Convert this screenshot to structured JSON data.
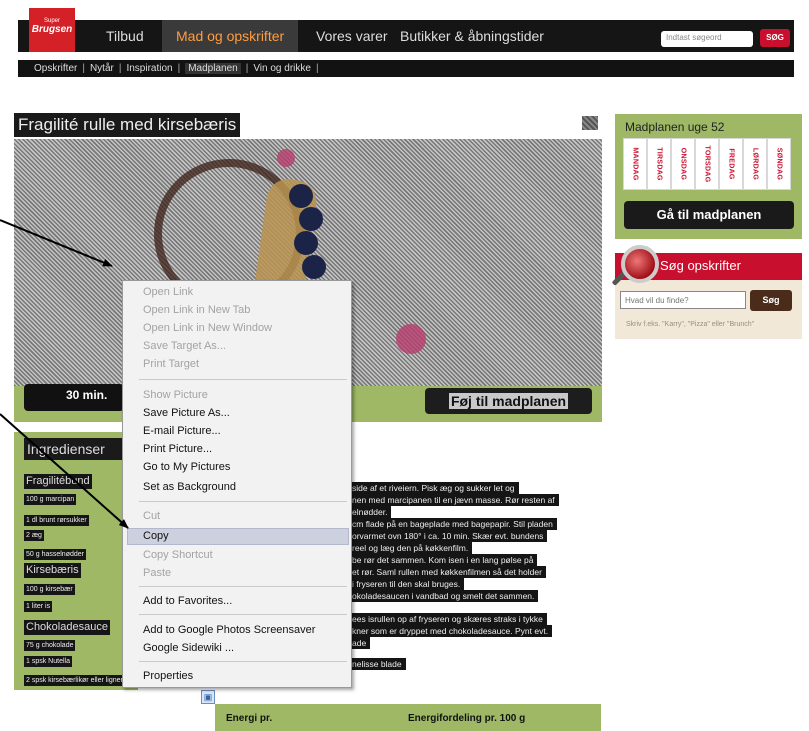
{
  "header": {
    "logo": {
      "line1": "Super",
      "line2": "Brugsen"
    },
    "nav": [
      "Tilbud",
      "Mad og opskrifter",
      "Vores varer",
      "Butikker & åbningstider"
    ],
    "search_placeholder": "Indtast søgeord",
    "search_button": "SØG",
    "subnav": [
      "Opskrifter",
      "Nytår",
      "Inspiration",
      "Madplanen",
      "Vin og drikke"
    ]
  },
  "recipe": {
    "title": "Fragilité rulle med kirsebæris",
    "time": "30 min.",
    "add_to_plan": "Føj til madplanen"
  },
  "ingredients": {
    "title": "Ingredienser",
    "groups": [
      {
        "name": "Fragilitébund",
        "items": [
          "100 g marcipan",
          "1 dl brunt rørsukker",
          "2 æg",
          "50 g hasselnødder"
        ]
      },
      {
        "name": "Kirsebæris",
        "items": [
          "100 g kirsebær",
          "1 liter is"
        ]
      },
      {
        "name": "Chokoladesauce",
        "items": [
          "75 g chokolade",
          "1 spsk Nutella",
          "2 spsk kirsebærlikør eller lignende"
        ]
      }
    ]
  },
  "method": [
    "side af et riveiern. Pisk æg og sukker let og",
    "nen med marcipanen til en jævn masse. Rør resten af",
    "elnødder.",
    "cm flade på en bageplade med bagepapir. Stil pladen",
    "orvarmet ovn 180° i ca. 10 min. Skær evt. bundens",
    "reel og læg den på køkkenfilm.",
    "be rør det sammen. Kom isen i en lang pølse på",
    "et rør. Saml rullen med køkkenfilmen så det holder",
    "i fryseren til den skal bruges.",
    "okoladesaucen i vandbad og smelt det sammen.",
    "ees isrullen op af fryseren og skæres straks i tykke",
    "kner som er dryppet med chokoladesauce. Pynt evt.",
    "ade",
    "nelisse blade"
  ],
  "nutrition": {
    "col1": "Energi pr.",
    "col2": "Energifordeling pr. 100 g"
  },
  "sidebar": {
    "plan_title": "Madplanen uge 52",
    "days": [
      "MANDAG",
      "TIRSDAG",
      "ONSDAG",
      "TORSDAG",
      "FREDAG",
      "LØRDAG",
      "SØNDAG"
    ],
    "goto_plan": "Gå til madplanen",
    "search_title": "Søg opskrifter",
    "search_placeholder": "Hvad vil du finde?",
    "search_button": "Søg",
    "search_hint": "Skriv f.eks. \"Karry\", \"Pizza\" eller \"Brunch\""
  },
  "context_menu": {
    "group1": [
      "Open Link",
      "Open Link in New Tab",
      "Open Link in New Window",
      "Save Target As...",
      "Print Target"
    ],
    "group2": [
      "Show Picture",
      "Save Picture As...",
      "E-mail Picture...",
      "Print Picture...",
      "Go to My Pictures",
      "Set as Background"
    ],
    "group3": [
      "Cut",
      "Copy",
      "Copy Shortcut",
      "Paste"
    ],
    "group4": [
      "Add to Favorites..."
    ],
    "group5": [
      "Add to Google Photos Screensaver",
      "Google Sidewiki ..."
    ],
    "group6": [
      "Properties"
    ],
    "highlighted": "Copy"
  }
}
